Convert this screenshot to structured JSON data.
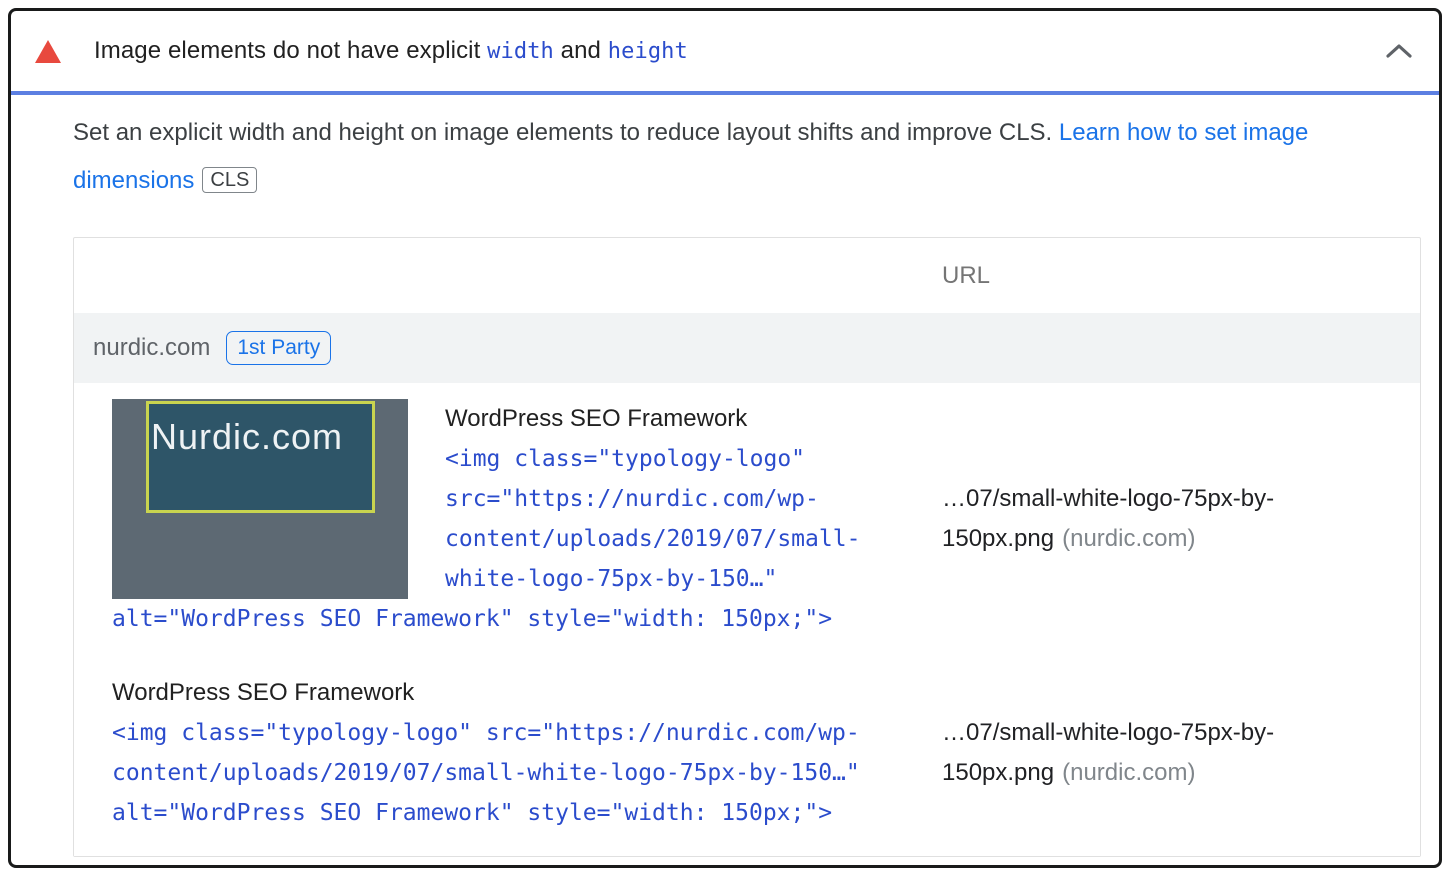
{
  "colors": {
    "warning_red": "#e8493e",
    "divider_blue": "#5c7fe2",
    "link_blue": "#1a73e8",
    "code_blue": "#2b4ccc",
    "group_row_bg": "#f1f3f4",
    "thumb_bg": "#5d6973",
    "thumb_logo_bg": "#2e5568",
    "thumb_logo_border": "#c9d44f"
  },
  "header": {
    "title_part1": "Image elements do not have explicit ",
    "code_width": "width",
    "title_part2": " and ",
    "code_height": "height",
    "collapse_icon": "chevron-up-icon"
  },
  "description": {
    "text": "Set an explicit width and height on image elements to reduce layout shifts and improve CLS. ",
    "link_label": "Learn how to set image dimensions",
    "tag": "CLS"
  },
  "table": {
    "url_header": "URL",
    "group": {
      "domain": "nurdic.com",
      "badge": "1st Party"
    },
    "items": [
      {
        "thumbnail_text": "Nurdic.com",
        "label": "WordPress SEO Framework",
        "code_lines": [
          "<img class=\"typology-logo\"",
          "src=\"https://nurdic.com/wp-",
          "content/uploads/2019/07/small-",
          "white-logo-75px-by-150…\"",
          "alt=\"WordPress SEO Framework\" style=\"width: 150px;\">"
        ],
        "url": "…07/small-white-logo-75px-by-150px.png",
        "host": "(nurdic.com)"
      },
      {
        "label": "WordPress SEO Framework",
        "code_lines": [
          "<img class=\"typology-logo\" src=\"https://nurdic.com/wp-",
          "content/uploads/2019/07/small-white-logo-75px-by-150…\"",
          "alt=\"WordPress SEO Framework\" style=\"width: 150px;\">"
        ],
        "url": "…07/small-white-logo-75px-by-150px.png",
        "host": "(nurdic.com)"
      }
    ]
  }
}
